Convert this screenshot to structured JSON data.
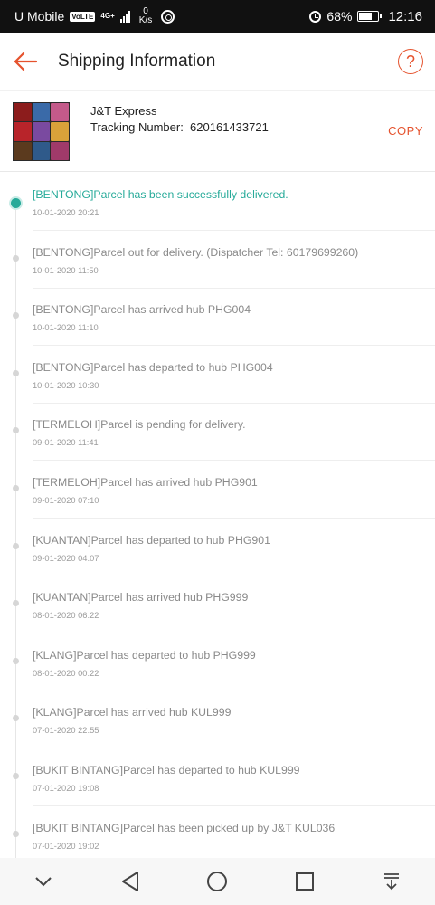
{
  "status_bar": {
    "carrier": "U Mobile",
    "volte": "VoLTE",
    "network": "4G+",
    "speed_value": "0",
    "speed_unit": "K/s",
    "battery": "68%",
    "battery_level": 0.68,
    "time": "12:16",
    "icons": [
      "signal-icon",
      "whatsapp-icon",
      "alarm-icon",
      "battery-icon"
    ]
  },
  "header": {
    "title": "Shipping Information",
    "back_icon": "arrow-left-icon",
    "help_icon": "question-circle-icon"
  },
  "package": {
    "carrier": "J&T Express",
    "tracking_label": "Tracking Number:",
    "tracking_number": "620161433721",
    "tracking_line": "Tracking Number:  620161433721",
    "copy_label": "COPY"
  },
  "events": [
    {
      "text": "[BENTONG]Parcel has been successfully delivered.",
      "time": "10-01-2020 20:21",
      "active": true
    },
    {
      "text": "[BENTONG]Parcel out for delivery. (Dispatcher Tel: 60179699260)",
      "time": "10-01-2020 11:50",
      "active": false
    },
    {
      "text": "[BENTONG]Parcel has arrived hub PHG004",
      "time": "10-01-2020 11:10",
      "active": false
    },
    {
      "text": "[BENTONG]Parcel has departed to hub PHG004",
      "time": "10-01-2020 10:30",
      "active": false
    },
    {
      "text": "[TERMELOH]Parcel is pending for delivery.",
      "time": "09-01-2020 11:41",
      "active": false
    },
    {
      "text": "[TERMELOH]Parcel has arrived hub PHG901",
      "time": "09-01-2020 07:10",
      "active": false
    },
    {
      "text": "[KUANTAN]Parcel has departed to hub PHG901",
      "time": "09-01-2020 04:07",
      "active": false
    },
    {
      "text": "[KUANTAN]Parcel has arrived hub PHG999",
      "time": "08-01-2020 06:22",
      "active": false
    },
    {
      "text": "[KLANG]Parcel has departed to hub PHG999",
      "time": "08-01-2020 00:22",
      "active": false
    },
    {
      "text": "[KLANG]Parcel has arrived hub KUL999",
      "time": "07-01-2020 22:55",
      "active": false
    },
    {
      "text": "[BUKIT BINTANG]Parcel has departed to hub KUL999",
      "time": "07-01-2020 19:08",
      "active": false
    },
    {
      "text": "[BUKIT BINTANG]Parcel has been picked up by J&T KUL036",
      "time": "07-01-2020 19:02",
      "active": false
    }
  ],
  "colors": {
    "accent": "#e5522d",
    "active_status": "#26aa99",
    "muted_text": "#8a8a8a"
  },
  "nav_bar": {
    "icons": [
      "chevron-down-icon",
      "back-triangle-icon",
      "home-circle-icon",
      "recents-square-icon",
      "notification-pull-icon"
    ]
  }
}
